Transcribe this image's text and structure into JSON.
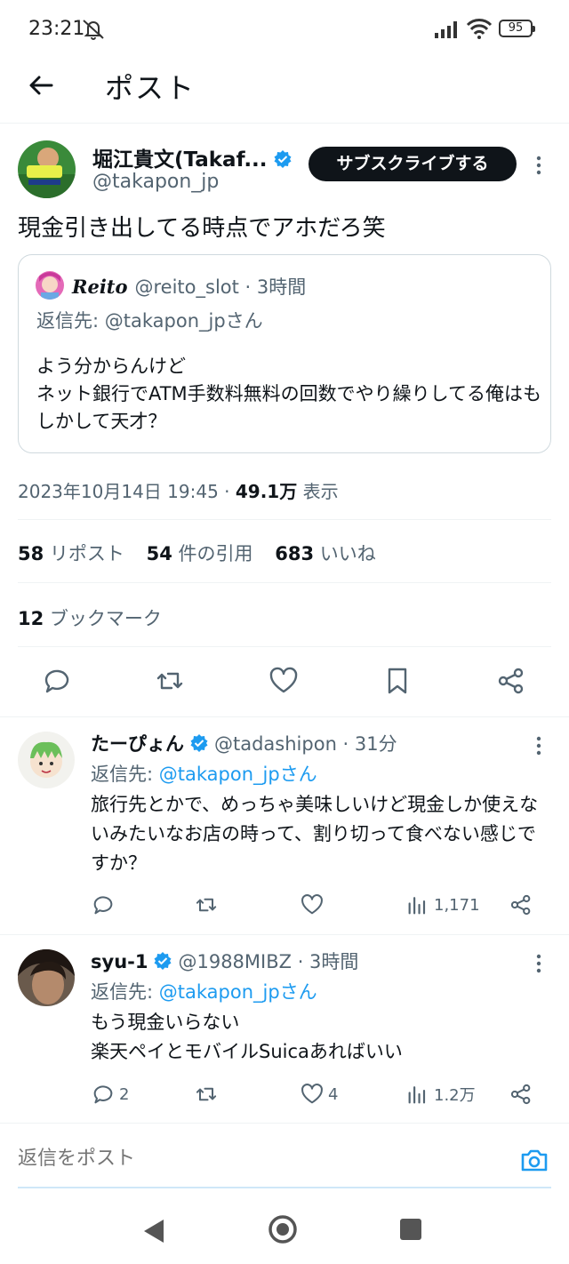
{
  "status_bar": {
    "time": "23:21",
    "battery": "95"
  },
  "header": {
    "title": "ポスト"
  },
  "post": {
    "author_name": "堀江貴文(Takaf...",
    "author_handle": "@takapon_jp",
    "subscribe_label": "サブスクライブする",
    "text": "現金引き出してる時点でアホだろ笑",
    "quote": {
      "name": "Reito",
      "handle_time": "@reito_slot · 3時間",
      "reply_to": "返信先: @takapon_jpさん",
      "text_line1": "よう分からんけど",
      "text_line2": "ネット銀行でATM手数料無料の回数でやり繰りしてる俺はもしかして天才？"
    },
    "timestamp": "2023年10月14日 19:45 · ",
    "views_count": "49.1万",
    "views_label": " 表示",
    "reposts_count": "58",
    "reposts_label": " リポスト",
    "quotes_count": "54",
    "quotes_label": " 件の引用",
    "likes_count": "683",
    "likes_label": " いいね",
    "bookmarks_count": "12",
    "bookmarks_label": " ブックマーク"
  },
  "replies": [
    {
      "name": "たーぴょん",
      "handle_time": "@tadashipon · 31分",
      "reply_prefix": "返信先: ",
      "reply_mention": "@takapon_jpさん",
      "text": "旅行先とかで、めっちゃ美味しいけど現金しか使えないみたいなお店の時って、割り切って食べない感じですか？",
      "replies": "",
      "reposts": "",
      "likes": "",
      "views": "1,171"
    },
    {
      "name": "syu-1",
      "handle_time": "@1988MIBZ · 3時間",
      "reply_prefix": "返信先: ",
      "reply_mention": "@takapon_jpさん",
      "text_line1": "もう現金いらない",
      "text_line2": "楽天ペイとモバイルSuicaあればいい",
      "replies": "2",
      "reposts": "",
      "likes": "4",
      "views": "1.2万"
    }
  ],
  "composer": {
    "placeholder": "返信をポスト"
  },
  "colors": {
    "accent": "#1d9bf0",
    "text": "#0f1419",
    "muted": "#536471"
  }
}
